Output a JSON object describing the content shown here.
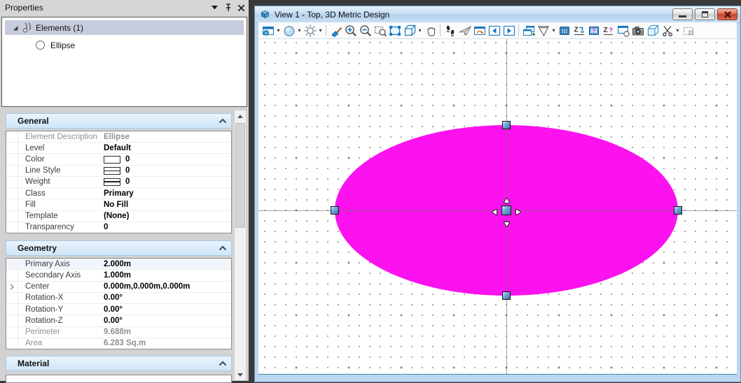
{
  "colors": {
    "accent_blue": "#1878BE",
    "selection_magenta": "#FB12EE",
    "handle_blue": "#3B6EA5",
    "section_header_bg": "#D9EAF9",
    "view_frame": "#BCD6EE"
  },
  "properties_panel": {
    "title": "Properties",
    "titlebar_icons": [
      "dropdown-caret",
      "pin",
      "close"
    ],
    "tree": {
      "root_label": "Elements (1)",
      "items": [
        {
          "label": "Ellipse",
          "icon": "ellipse-icon"
        }
      ]
    },
    "sections": [
      {
        "id": "general",
        "title": "General",
        "rows": [
          {
            "label": "Element Description",
            "value": "Ellipse",
            "muted": true
          },
          {
            "label": "Level",
            "value": "Default"
          },
          {
            "label": "Color",
            "value": "0",
            "swatch": "color"
          },
          {
            "label": "Line Style",
            "value": "0",
            "swatch": "linestyle"
          },
          {
            "label": "Weight",
            "value": "0",
            "swatch": "weight"
          },
          {
            "label": "Class",
            "value": "Primary"
          },
          {
            "label": "Fill",
            "value": "No Fill"
          },
          {
            "label": "Template",
            "value": "(None)"
          },
          {
            "label": "Transparency",
            "value": "0"
          }
        ]
      },
      {
        "id": "geometry",
        "title": "Geometry",
        "rows": [
          {
            "label": "Primary Axis",
            "value": "2.000m",
            "tint": true
          },
          {
            "label": "Secondary Axis",
            "value": "1.000m"
          },
          {
            "label": "Center",
            "value": "0.000m,0.000m,0.000m",
            "expander": true
          },
          {
            "label": "Rotation-X",
            "value": "0.00°"
          },
          {
            "label": "Rotation-Y",
            "value": "0.00°"
          },
          {
            "label": "Rotation-Z",
            "value": "0.00°"
          },
          {
            "label": "Perimeter",
            "value": "9.688m",
            "muted": true
          },
          {
            "label": "Area",
            "value": "6.283 Sq.m",
            "muted": true
          }
        ]
      },
      {
        "id": "material",
        "title": "Material",
        "rows": []
      }
    ]
  },
  "view_window": {
    "title": "View 1 - Top, 3D Metric Design",
    "window_buttons": [
      "minimize",
      "restore",
      "close"
    ],
    "toolbar": [
      {
        "name": "view-attributes",
        "dropdown": true
      },
      {
        "name": "display-style",
        "dropdown": true
      },
      {
        "name": "view-brightness",
        "dropdown": true
      },
      {
        "sep": true
      },
      {
        "name": "update-view"
      },
      {
        "name": "zoom-in"
      },
      {
        "name": "zoom-out"
      },
      {
        "name": "window-area"
      },
      {
        "name": "fit-view"
      },
      {
        "name": "rotate-view",
        "dropdown": true
      },
      {
        "name": "pan-view"
      },
      {
        "sep": true
      },
      {
        "name": "walk"
      },
      {
        "name": "fly"
      },
      {
        "name": "navigate-view"
      },
      {
        "name": "view-previous"
      },
      {
        "name": "view-next"
      },
      {
        "sep": true
      },
      {
        "name": "copy-view"
      },
      {
        "name": "view-perspective",
        "dropdown": true
      },
      {
        "name": "display-rules"
      },
      {
        "name": "change-display-depth"
      },
      {
        "name": "set-display-depth"
      },
      {
        "name": "show-display-depth"
      },
      {
        "name": "render-view"
      },
      {
        "name": "camera-settings"
      },
      {
        "name": "clip-volume"
      },
      {
        "name": "clip-mask",
        "dropdown": true
      },
      {
        "name": "section-box"
      }
    ],
    "canvas": {
      "selected_element": "Ellipse",
      "fill_color": "#FB12EE",
      "handles": [
        "north",
        "south",
        "west",
        "east",
        "center"
      ]
    }
  }
}
